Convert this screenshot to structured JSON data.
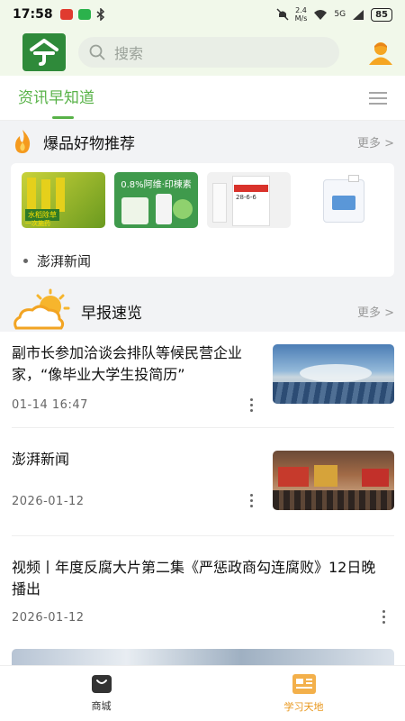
{
  "status_bar": {
    "time": "17:58",
    "net_speed_value": "2.4",
    "net_speed_unit": "M/s",
    "signal_label": "5G",
    "battery": "85"
  },
  "header": {
    "logo_icon": "app-logo-icon",
    "search_placeholder": "搜索"
  },
  "tabs": {
    "active_label": "资讯早知道"
  },
  "hot_products": {
    "title": "爆品好物推荐",
    "more_label": "更多 >",
    "product_1_texts": [
      "水稻除草",
      "一次施药"
    ],
    "product_2_text": "0.8%阿维·印楝素",
    "product_3_text": "28-6-6",
    "news_label": "澎湃新闻"
  },
  "morning_report": {
    "title": "早报速览",
    "more_label": "更多 >"
  },
  "news": [
    {
      "title": "副市长参加洽谈会排队等候民营企业家，“像毕业大学生投简历”",
      "meta": "01-14  16:47"
    },
    {
      "title": "澎湃新闻",
      "meta": "2026-01-12"
    },
    {
      "title": "视频丨年度反腐大片第二集《严惩政商勾连腐败》12日晚播出",
      "meta": "2026-01-12"
    }
  ],
  "bottom_nav": [
    {
      "label": "商城",
      "icon": "shopping-bag-icon"
    },
    {
      "label": "学习天地",
      "icon": "news-icon"
    }
  ],
  "colors": {
    "accent_green": "#58b248",
    "active_orange": "#e8961a",
    "header_bg": "#f1f8ea"
  }
}
